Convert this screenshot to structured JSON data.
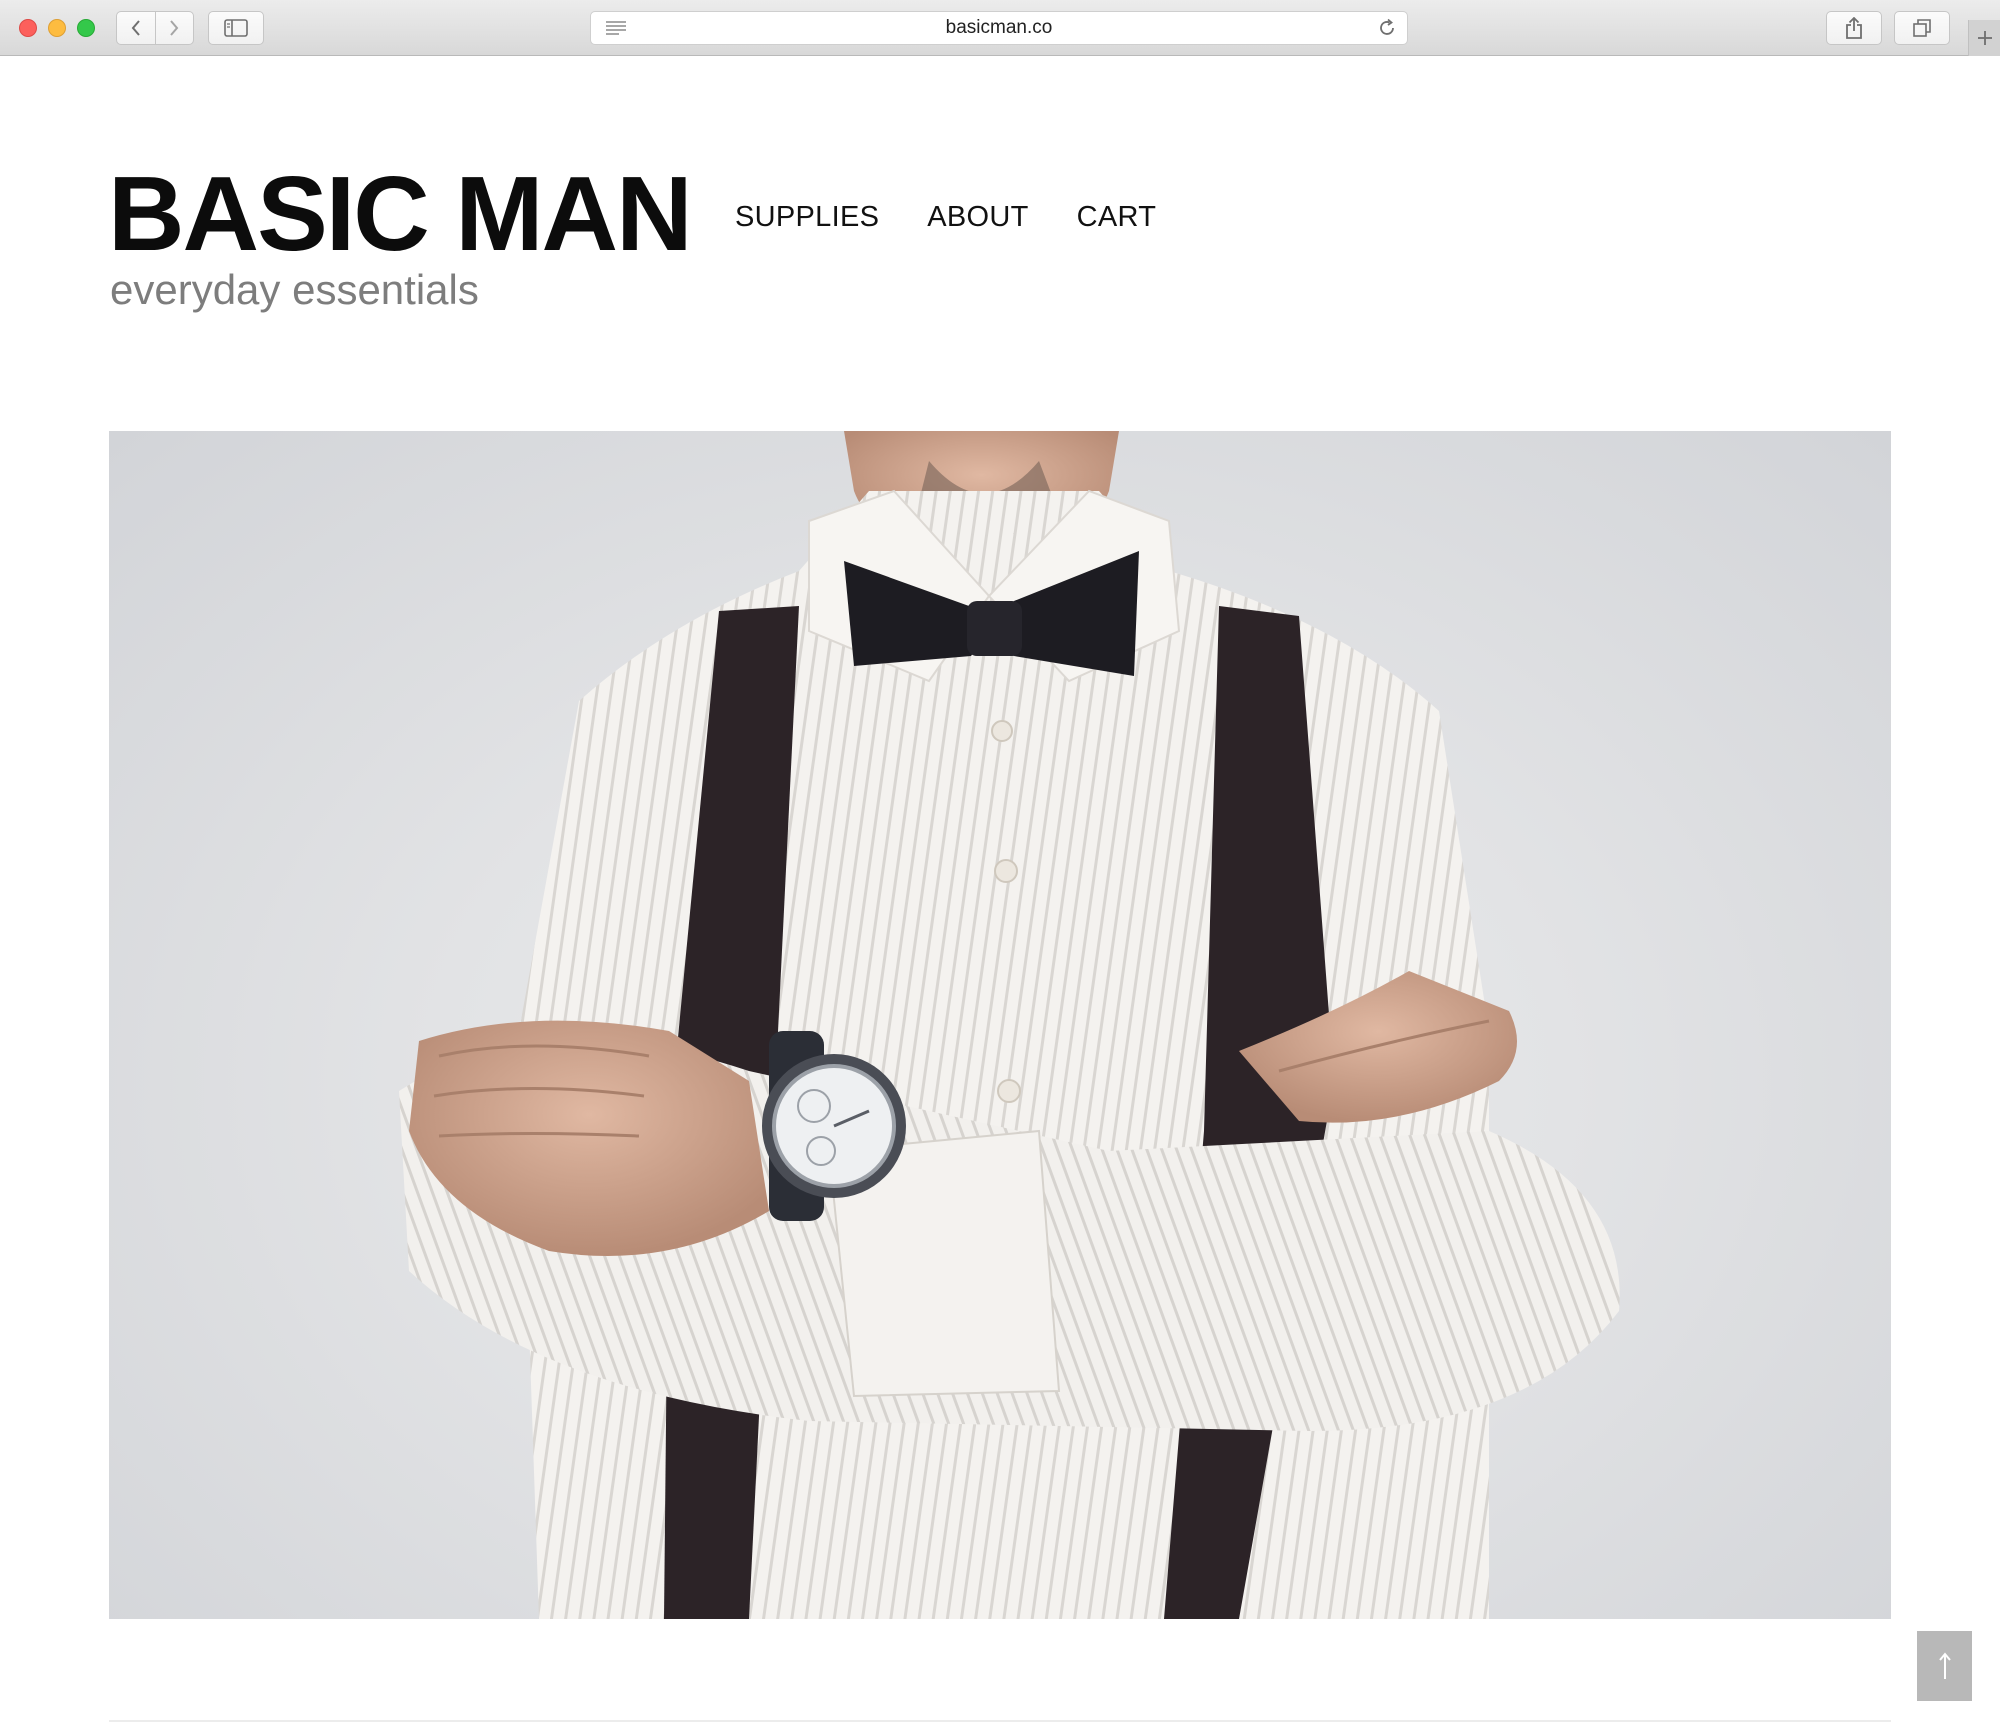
{
  "browser": {
    "url": "basicman.co"
  },
  "site": {
    "title": "BASIC MAN",
    "tagline": "everyday essentials"
  },
  "nav": {
    "items": [
      {
        "label": "SUPPLIES"
      },
      {
        "label": "ABOUT"
      },
      {
        "label": "CART"
      }
    ]
  },
  "colors": {
    "accent": "#0c0c0c",
    "tagline": "#7d7d7d",
    "back_to_top": "#b8b8b8"
  },
  "icons": {
    "back_to_top": "arrow-up-icon"
  },
  "hero": {
    "alt": "man in white striped shirt with bow tie, suspenders and wristwatch, arms crossed"
  }
}
